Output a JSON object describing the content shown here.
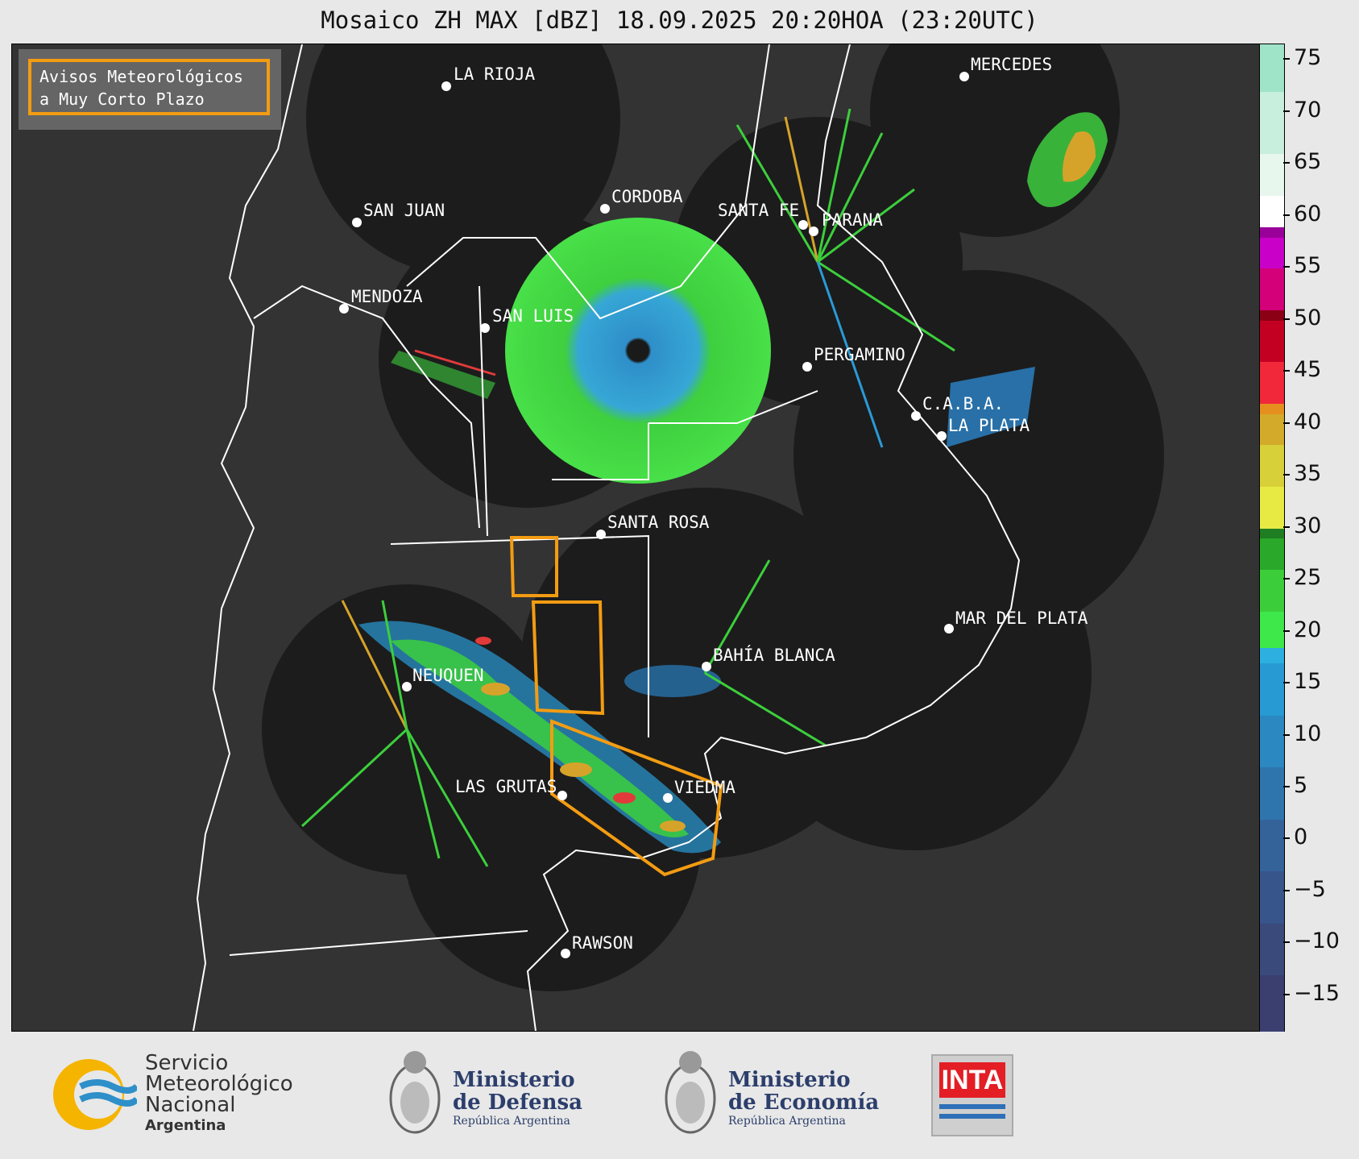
{
  "title": "Mosaico ZH MAX [dBZ] 18.09.2025 20:20HOA (23:20UTC)",
  "legend": {
    "line1": "Avisos Meteorológicos",
    "line2": "a Muy Corto Plazo",
    "color": "#f39c12"
  },
  "cities": [
    {
      "name": "LA RIOJA"
    },
    {
      "name": "MERCEDES"
    },
    {
      "name": "SAN JUAN"
    },
    {
      "name": "CORDOBA"
    },
    {
      "name": "SANTA FE"
    },
    {
      "name": "PARANA"
    },
    {
      "name": "MENDOZA"
    },
    {
      "name": "SAN LUIS"
    },
    {
      "name": "PERGAMINO"
    },
    {
      "name": "C.A.B.A."
    },
    {
      "name": "LA PLATA"
    },
    {
      "name": "SANTA ROSA"
    },
    {
      "name": "MAR DEL PLATA"
    },
    {
      "name": "BAHÍA BLANCA"
    },
    {
      "name": "NEUQUEN"
    },
    {
      "name": "LAS GRUTAS"
    },
    {
      "name": "VIEDMA"
    },
    {
      "name": "RAWSON"
    }
  ],
  "colorbar": {
    "unit": "dBZ",
    "ticks": [
      "75",
      "70",
      "65",
      "60",
      "55",
      "50",
      "45",
      "40",
      "35",
      "30",
      "25",
      "20",
      "15",
      "10",
      "5",
      "0",
      "−5",
      "−10",
      "−15"
    ],
    "range": [
      -18.5,
      76.5
    ]
  },
  "footer": {
    "smn_line1": "Servicio",
    "smn_line2": "Meteorológico",
    "smn_line3": "Nacional",
    "smn_line4": "Argentina",
    "defensa_line1": "Ministerio",
    "defensa_line2": "de Defensa",
    "defensa_line3": "República Argentina",
    "economia_line1": "Ministerio",
    "economia_line2": "de Economía",
    "economia_line3": "República Argentina",
    "inta": "INTA"
  }
}
